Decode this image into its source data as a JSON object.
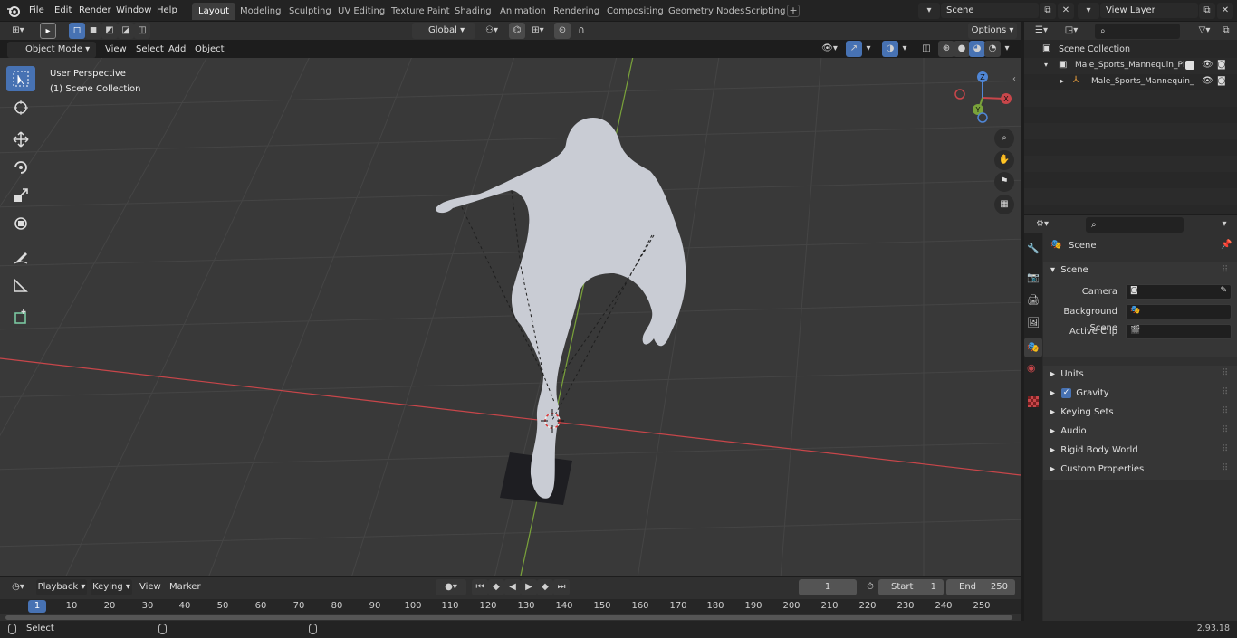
{
  "menu": [
    "File",
    "Edit",
    "Render",
    "Window",
    "Help"
  ],
  "workspaces": [
    "Layout",
    "Modeling",
    "Sculpting",
    "UV Editing",
    "Texture Paint",
    "Shading",
    "Animation",
    "Rendering",
    "Compositing",
    "Geometry Nodes",
    "Scripting"
  ],
  "scene_field": "Scene",
  "view_layer_field": "View Layer",
  "viewport_header": {
    "mode": "Object Mode",
    "view": "View",
    "select": "Select",
    "add": "Add",
    "object": "Object",
    "transform_orientation": "Global",
    "options": "Options"
  },
  "viewport_overlay": {
    "perspective": "User Perspective",
    "collection": "(1) Scene Collection"
  },
  "gizmo": {
    "z": "Z",
    "x": "X",
    "y": "Y"
  },
  "outliner": {
    "root": "Scene Collection",
    "items": [
      {
        "label": "Male_Sports_Mannequin_Play"
      },
      {
        "label": "Male_Sports_Mannequin_"
      }
    ]
  },
  "properties": {
    "header": "Scene",
    "panel": "Scene",
    "fields": [
      {
        "label": "Camera"
      },
      {
        "label": "Background Scene"
      },
      {
        "label": "Active Clip"
      }
    ],
    "sections": [
      "Units",
      "Gravity",
      "Keying Sets",
      "Audio",
      "Rigid Body World",
      "Custom Properties"
    ]
  },
  "timeline": {
    "playback": "Playback",
    "keying": "Keying",
    "view": "View",
    "marker": "Marker",
    "current_frame": "1",
    "start_label": "Start",
    "start": "1",
    "end_label": "End",
    "end": "250",
    "ticks": [
      "1",
      "10",
      "20",
      "30",
      "40",
      "50",
      "60",
      "70",
      "80",
      "90",
      "100",
      "110",
      "120",
      "130",
      "140",
      "150",
      "160",
      "170",
      "180",
      "190",
      "200",
      "210",
      "220",
      "230",
      "240",
      "250"
    ]
  },
  "status": {
    "select": "Select",
    "version": "2.93.18"
  },
  "colors": {
    "accent": "#4772b3",
    "x_axis": "#c8464a",
    "y_axis": "#7aa33a",
    "mesh": "#c9ccd4"
  }
}
